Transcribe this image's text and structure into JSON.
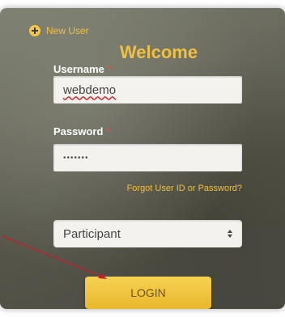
{
  "new_user": {
    "label": "New User",
    "icon": "plus-circle-icon"
  },
  "title": "Welcome",
  "username": {
    "label": "Username",
    "required_mark": "*",
    "value": "webdemo"
  },
  "password": {
    "label": "Password",
    "required_mark": "*",
    "value": "•••••••"
  },
  "forgot_link": "Forgot User ID or Password?",
  "role_select": {
    "value": "Participant"
  },
  "login_button": "LOGIN",
  "colors": {
    "accent": "#f0c043",
    "required": "#e8543c",
    "arrow": "#c0202a"
  }
}
